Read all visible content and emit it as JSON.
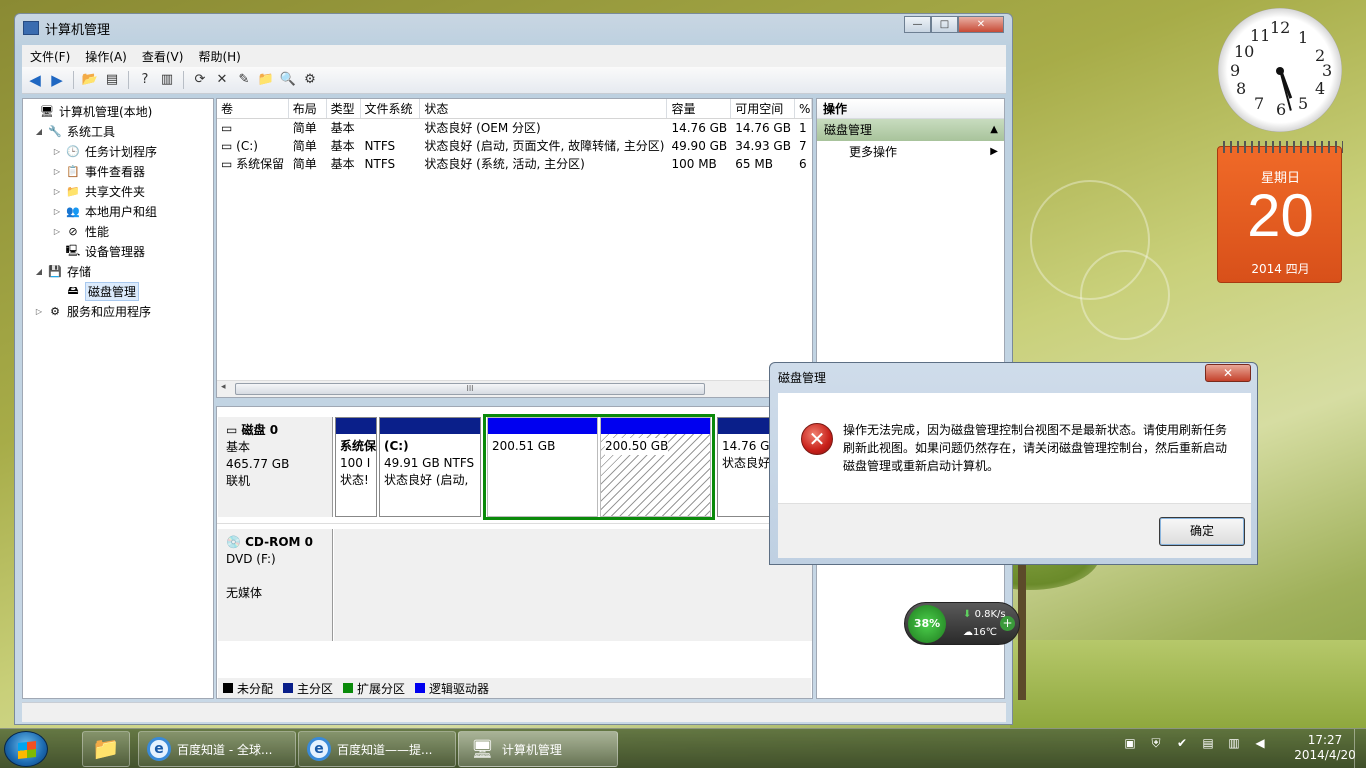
{
  "window": {
    "title": "计算机管理",
    "controls": {
      "minimize": "—",
      "maximize": "□",
      "close": "✕"
    }
  },
  "menu": [
    "文件(F)",
    "操作(A)",
    "查看(V)",
    "帮助(H)"
  ],
  "tree": [
    {
      "label": "计算机管理(本地)",
      "icon": "computer-icon",
      "glyph": "🖥",
      "arrow": ""
    },
    {
      "label": "系统工具",
      "icon": "tools-icon",
      "glyph": "🔧",
      "arrow": "◢"
    },
    {
      "label": "任务计划程序",
      "icon": "clock-icon",
      "glyph": "🕒",
      "arrow": "▷"
    },
    {
      "label": "事件查看器",
      "icon": "event-viewer-icon",
      "glyph": "📋",
      "arrow": "▷"
    },
    {
      "label": "共享文件夹",
      "icon": "shared-folder-icon",
      "glyph": "📁",
      "arrow": "▷"
    },
    {
      "label": "本地用户和组",
      "icon": "users-icon",
      "glyph": "👥",
      "arrow": "▷"
    },
    {
      "label": "性能",
      "icon": "performance-icon",
      "glyph": "⊘",
      "arrow": "▷"
    },
    {
      "label": "设备管理器",
      "icon": "device-manager-icon",
      "glyph": "🖳",
      "arrow": ""
    },
    {
      "label": "存储",
      "icon": "storage-icon",
      "glyph": "💾",
      "arrow": "◢"
    },
    {
      "label": "磁盘管理",
      "icon": "disk-management-icon",
      "glyph": "🖴",
      "arrow": ""
    },
    {
      "label": "服务和应用程序",
      "icon": "services-icon",
      "glyph": "⚙",
      "arrow": "▷"
    }
  ],
  "list": {
    "columns": [
      "卷",
      "布局",
      "类型",
      "文件系统",
      "状态",
      "容量",
      "可用空间",
      "%"
    ],
    "rows": [
      [
        "",
        "简单",
        "基本",
        "",
        "状态良好 (OEM 分区)",
        "14.76 GB",
        "14.76 GB",
        "1"
      ],
      [
        "(C:)",
        "简单",
        "基本",
        "NTFS",
        "状态良好 (启动, 页面文件, 故障转储, 主分区)",
        "49.90 GB",
        "34.93 GB",
        "7"
      ],
      [
        "系统保留",
        "简单",
        "基本",
        "NTFS",
        "状态良好 (系统, 活动, 主分区)",
        "100 MB",
        "65 MB",
        "6"
      ]
    ],
    "scroll_glyph": "III"
  },
  "disks": {
    "disk0": {
      "name": "磁盘 0",
      "type": "基本",
      "size": "465.77 GB",
      "state": "联机"
    },
    "cdrom0": {
      "name": "CD-ROM 0",
      "drive": "DVD (F:)",
      "media": "无媒体"
    },
    "partitions": [
      {
        "line1": "系统保",
        "line2": "100 I",
        "line3": "状态!"
      },
      {
        "line1": "(C:)",
        "line2": "49.91 GB NTFS",
        "line3": "状态良好 (启动,"
      },
      {
        "line1": "",
        "line2": "200.51 GB",
        "line3": ""
      },
      {
        "line1": "",
        "line2": "200.50 GB",
        "line3": ""
      },
      {
        "line1": "",
        "line2": "14.76 GB",
        "line3": "状态良好"
      }
    ]
  },
  "legend": [
    {
      "label": "未分配",
      "color": "#000000"
    },
    {
      "label": "主分区",
      "color": "#0a1f8a"
    },
    {
      "label": "扩展分区",
      "color": "#0a8a0a"
    },
    {
      "label": "逻辑驱动器",
      "color": "#0000f0"
    }
  ],
  "actions": {
    "header": "操作",
    "section": "磁盘管理",
    "item": "更多操作"
  },
  "dialog": {
    "title": "磁盘管理",
    "message": "操作无法完成，因为磁盘管理控制台视图不是最新状态。请使用刷新任务刷新此视图。如果问题仍然存在，请关闭磁盘管理控制台，然后重新启动磁盘管理或重新启动计算机。",
    "ok": "确定",
    "close": "✕"
  },
  "gadgets": {
    "calendar": {
      "weekday": "星期日",
      "day": "20",
      "year_month": "2014 四月"
    },
    "network": {
      "percent": "38%",
      "speed": "0.8K/s",
      "temp": "16℃"
    },
    "clock_numbers": [
      "12",
      "1",
      "2",
      "3",
      "4",
      "5",
      "6",
      "7",
      "8",
      "9",
      "10",
      "11"
    ]
  },
  "taskbar": {
    "buttons": [
      "百度知道 - 全球...",
      "百度知道——提...",
      "计算机管理"
    ],
    "time": "17:27",
    "date": "2014/4/20"
  }
}
